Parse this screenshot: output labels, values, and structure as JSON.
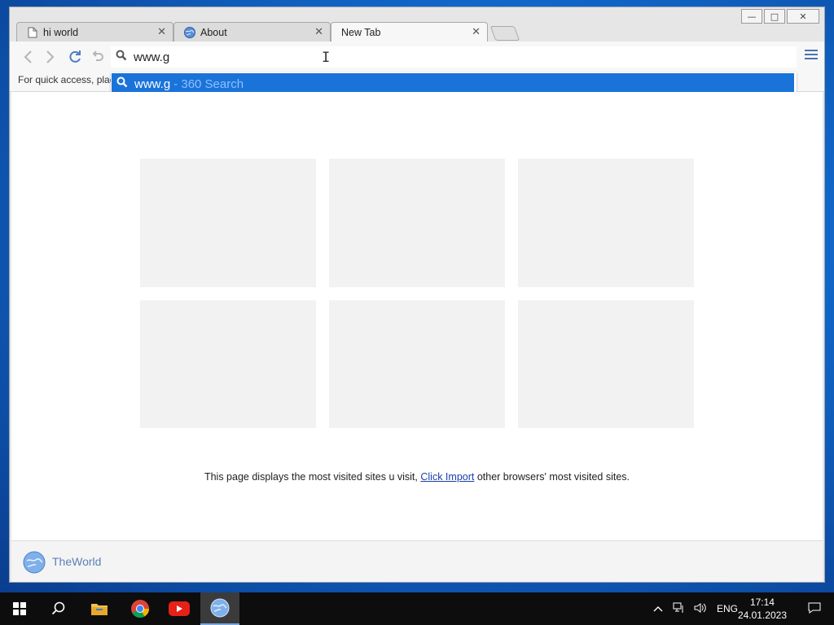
{
  "window": {
    "controls": {
      "minimize": "—",
      "maximize": "□",
      "close": "✕"
    }
  },
  "tabs": [
    {
      "label": "hi world",
      "icon": "page-icon",
      "active": false
    },
    {
      "label": "About",
      "icon": "globe-icon",
      "active": false
    },
    {
      "label": "New Tab",
      "icon": "",
      "active": true
    }
  ],
  "toolbar": {
    "back": "‹",
    "forward": "›",
    "address_value": "www.g"
  },
  "bookmark_bar": {
    "hint": "For quick access, plac"
  },
  "autocomplete": {
    "query": "www.g",
    "engine_hint": "- 360 Search"
  },
  "page": {
    "info_prefix": "This page displays the most visited sites u visit,",
    "info_link": "Click Import",
    "info_suffix": "other browsers' most visited sites.",
    "tile_count": 6
  },
  "footer": {
    "brand": "TheWorld"
  },
  "taskbar": {
    "items": [
      "windows-start-icon",
      "search-icon",
      "file-explorer-icon",
      "chrome-icon",
      "youtube-icon",
      "theworld-browser-icon"
    ],
    "language": "ENG",
    "time": "17:14",
    "date": "24.01.2023"
  },
  "colors": {
    "accent": "#1a73d9",
    "link": "#1a3faa",
    "taskbar": "#0d0d0d"
  }
}
